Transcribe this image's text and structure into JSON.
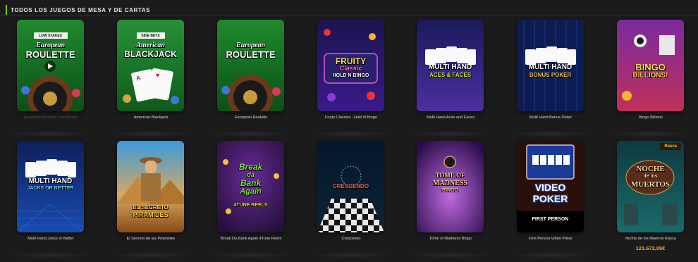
{
  "section": {
    "title": "TODOS LOS JUEGOS DE MESA Y DE CARTAS"
  },
  "colors": {
    "accent": "#6dd400",
    "jackpot": "#e4b23c"
  },
  "games": [
    {
      "label": "European Roulette Low Stakes",
      "thumb_lines": [
        "LOW STAKES",
        "European",
        "ROULETTE"
      ]
    },
    {
      "label": "American Blackjack",
      "thumb_lines": [
        "SIDE BETS",
        "American",
        "BLACKJACK"
      ]
    },
    {
      "label": "European Roulette",
      "thumb_lines": [
        "European",
        "ROULETTE"
      ]
    },
    {
      "label": "Fruity Classics : Hold N Bingo",
      "thumb_lines": [
        "FRUITY",
        "Classic",
        "HOLD N BINGO"
      ]
    },
    {
      "label": "Multi Hand Aces and Faces",
      "thumb_lines": [
        "MULTI HAND",
        "ACES & FACES"
      ]
    },
    {
      "label": "Multi Hand Bonus Poker",
      "thumb_lines": [
        "MULTI HAND",
        "BONUS POKER"
      ]
    },
    {
      "label": "Bingo Billions",
      "thumb_lines": [
        "BINGO",
        "BILLIONS!"
      ]
    },
    {
      "label": "Multi Hand Jacks or Better",
      "thumb_lines": [
        "MULTI HAND",
        "JACKS OR BETTER"
      ]
    },
    {
      "label": "El Secreto de las Piramides",
      "thumb_lines": [
        "EL SECRETO",
        "PIRAMIDES"
      ]
    },
    {
      "label": "Break Da Bank Again 4Tune Reels",
      "thumb_lines": [
        "Break",
        "da",
        "Bank",
        "Again",
        "4TUNE REELS"
      ]
    },
    {
      "label": "Crescendo",
      "thumb_lines": [
        "CRESCENDO"
      ]
    },
    {
      "label": "Tome of Madness Bingo",
      "thumb_lines": [
        "TOME OF",
        "MADNESS",
        "BINGO"
      ]
    },
    {
      "label": "First Person Video Poker",
      "thumb_lines": [
        "VIDEO",
        "POKER",
        "FIRST PERSON"
      ]
    },
    {
      "label": "Noche de los Muertos Rasca",
      "thumb_lines": [
        "NOCHE",
        "de los",
        "MUERTOS"
      ],
      "badge": "Rasca",
      "jackpot": "121.672,05€"
    }
  ]
}
